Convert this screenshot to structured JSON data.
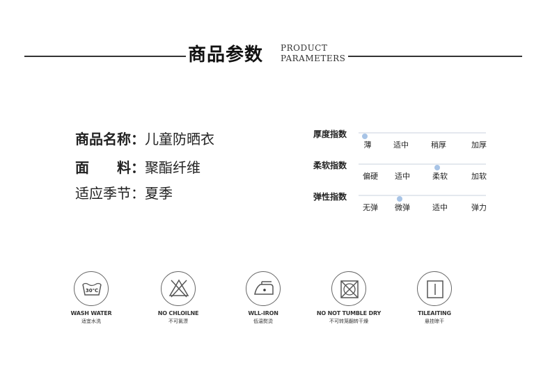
{
  "header": {
    "title": "商品参数",
    "en_line1": "PRODUCT",
    "en_line2": "PARAMETERS"
  },
  "product": {
    "name_label": "商品名称：",
    "name_value": "儿童防晒衣",
    "fabric_label": "面　　料：",
    "fabric_value": "聚酯纤维",
    "season_label": "适应季节：",
    "season_value": "夏季"
  },
  "scales": [
    {
      "label": "厚度指数",
      "options": [
        "薄",
        "适中",
        "稍厚",
        "加厚"
      ],
      "selected_position": 0.05
    },
    {
      "label": "柔软指数",
      "options": [
        "偏硬",
        "适中",
        "柔软",
        "加软"
      ],
      "selected_position": 0.62
    },
    {
      "label": "弹性指数",
      "options": [
        "无弹",
        "微弹",
        "适中",
        "弹力"
      ],
      "selected_position": 0.32
    }
  ],
  "care": [
    {
      "icon": "wash-30c-icon",
      "en": "WASH WATER",
      "cn": "适宜水洗",
      "temp": "30℃"
    },
    {
      "icon": "no-bleach-icon",
      "en": "NO CHLOILNE",
      "cn": "不可氯漂"
    },
    {
      "icon": "low-iron-icon",
      "en": "WLL-IRON",
      "cn": "低温熨烫"
    },
    {
      "icon": "no-tumble-dry-icon",
      "en": "NO NOT TUMBLE DRY",
      "cn": "不可转笼翻转干燥"
    },
    {
      "icon": "hang-dry-icon",
      "en": "TILEAITING",
      "cn": "悬挂晾干"
    }
  ],
  "colors": {
    "dot": "#a8c4e6",
    "track": "#e4e8ee",
    "line": "#333333"
  }
}
